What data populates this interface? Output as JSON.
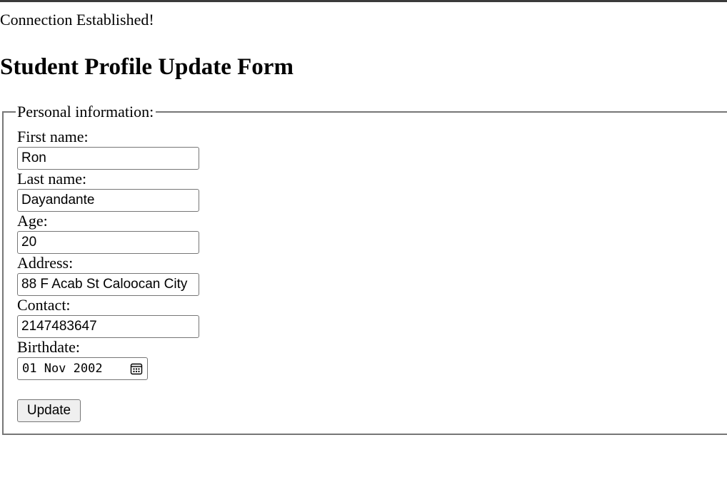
{
  "status_message": "Connection Established!",
  "page_title": "Student Profile Update Form",
  "form": {
    "legend": "Personal information:",
    "fields": {
      "first_name": {
        "label": "First name:",
        "value": "Ron"
      },
      "last_name": {
        "label": "Last name:",
        "value": "Dayandante"
      },
      "age": {
        "label": "Age:",
        "value": "20"
      },
      "address": {
        "label": "Address:",
        "value": "88 F Acab St Caloocan City"
      },
      "contact": {
        "label": "Contact:",
        "value": "2147483647"
      },
      "birthdate": {
        "label": "Birthdate:",
        "value": "01 Nov 2002",
        "icon": "calendar-icon"
      }
    },
    "submit_label": "Update"
  }
}
